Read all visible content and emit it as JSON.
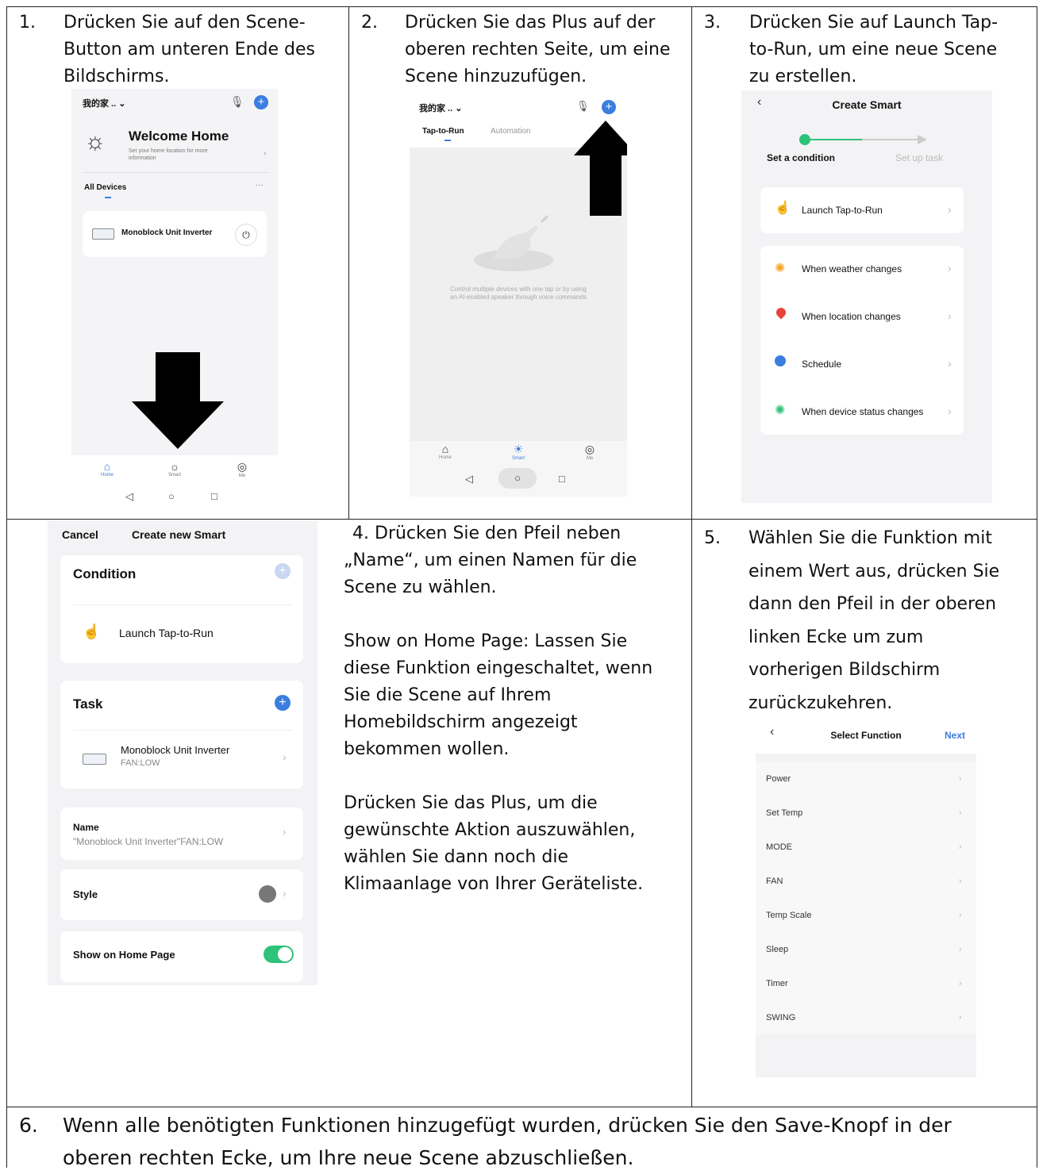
{
  "steps": {
    "s1": {
      "num": "1.",
      "lines": [
        "Drücken Sie auf den Scene-",
        "Button am unteren Ende des",
        "Bildschirms."
      ]
    },
    "s2": {
      "num": "2.",
      "lines": [
        "Drücken Sie das Plus auf der",
        "oberen rechten Seite, um eine",
        "Scene hinzuzufügen."
      ]
    },
    "s3": {
      "num": "3.",
      "lines": [
        "Drücken Sie auf Launch Tap-",
        "to-Run, um eine neue Scene",
        "zu erstellen."
      ]
    },
    "s4": {
      "num": "4.",
      "p1": [
        "Drücken Sie den Pfeil neben",
        "„Name“, um einen Namen für die",
        "Scene zu wählen."
      ],
      "p2": [
        "Show on Home Page: Lassen Sie",
        "diese Funktion eingeschaltet, wenn",
        "Sie die Scene auf Ihrem",
        "Homebildschirm angezeigt",
        "bekommen wollen."
      ],
      "p3": [
        "Drücken Sie das Plus, um die",
        "gewünschte Aktion auszuwählen,",
        "wählen Sie dann noch die",
        "Klimaanlage von Ihrer Geräteliste."
      ]
    },
    "s5": {
      "num": "5.",
      "lines": [
        "Wählen Sie die Funktion mit",
        "einem Wert aus, drücken Sie",
        "dann den Pfeil in der oberen",
        "linken Ecke um zum",
        "vorherigen Bildschirm",
        "zurückzukehren."
      ]
    },
    "s6": {
      "num": "6.",
      "lines": [
        "Wenn alle benötigten Funktionen hinzugefügt wurden, drücken Sie den Save-Knopf in der",
        "oberen rechten Ecke, um Ihre neue Scene abzuschließen."
      ]
    }
  },
  "shot1": {
    "home_selector": "我的家 .. ⌄",
    "welcome_title": "Welcome Home",
    "welcome_sub": [
      "Set your home location for more",
      "information"
    ],
    "all_devices": "All Devices",
    "more": "···",
    "device_name": "Monoblock Unit Inverter",
    "nav": [
      "Home",
      "Smart",
      "Me"
    ]
  },
  "shot2": {
    "home_selector": "我的家 .. ⌄",
    "tab_active": "Tap-to-Run",
    "tab_inactive": "Automation",
    "empty_text": [
      "Control multiple devices with one tap or by using",
      "an AI-enabled speaker through voice commands"
    ],
    "nav": [
      "Home",
      "Smart",
      "Me"
    ]
  },
  "shot3": {
    "title": "Create Smart",
    "step_active": "Set a condition",
    "step_inactive": "Set up task",
    "launch": "Launch Tap-to-Run",
    "conditions": [
      "When weather changes",
      "When location changes",
      "Schedule",
      "When device status changes"
    ],
    "colors": {
      "accent": "#2fc27a",
      "weather": "#f5a623",
      "location": "#e8433a",
      "schedule": "#3b7de0",
      "device": "#2fc27a"
    }
  },
  "shot4": {
    "cancel": "Cancel",
    "title": "Create new Smart",
    "condition": "Condition",
    "launch": "Launch Tap-to-Run",
    "task": "Task",
    "device": "Monoblock Unit Inverter",
    "device_sub": "FAN:LOW",
    "name_label": "Name",
    "name_value": "\"Monoblock Unit Inverter\"FAN:LOW",
    "style": "Style",
    "show_home": "Show on Home Page",
    "colors": {
      "plus": "#3b7de0",
      "toggle": "#2fc27a"
    }
  },
  "shot5": {
    "title": "Select Function",
    "next": "Next",
    "functions": [
      "Power",
      "Set Temp",
      "MODE",
      "FAN",
      "Temp Scale",
      "Sleep",
      "Timer",
      "SWING"
    ],
    "colors": {
      "next": "#3b7de0"
    }
  }
}
